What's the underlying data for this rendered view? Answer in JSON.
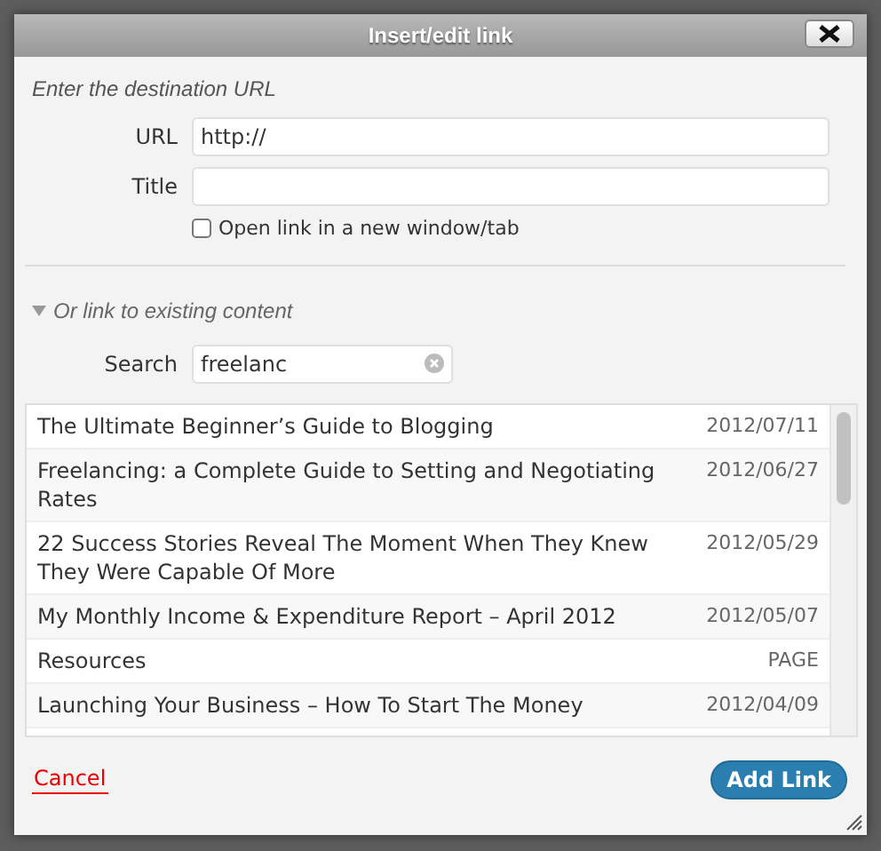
{
  "window": {
    "title": "Insert/edit link"
  },
  "url_section": {
    "heading": "Enter the destination URL",
    "fields": [
      {
        "label": "URL",
        "value": "http://"
      },
      {
        "label": "Title"
      }
    ],
    "new_window": {
      "label": "Open link in a new window/tab",
      "checked": false
    }
  },
  "existing": {
    "heading": "Or link to existing content",
    "expanded": true,
    "search": {
      "label": "Search",
      "value": "freelanc"
    },
    "results": [
      {
        "title": "The Ultimate Beginner’s Guide to Blogging",
        "info": "2012/07/11"
      },
      {
        "title": "Freelancing: a Complete Guide to Setting and Negotiating Rates",
        "info": "2012/06/27"
      },
      {
        "title": "22 Success Stories Reveal The Moment When They Knew They Were Capable Of More",
        "info": "2012/05/29"
      },
      {
        "title": "My Monthly Income & Expenditure Report – April 2012",
        "info": "2012/05/07"
      },
      {
        "title": "Resources",
        "info": "PAGE"
      },
      {
        "title": "Launching Your Business – How To Start The Money",
        "info": "2012/04/09"
      }
    ]
  },
  "footer": {
    "cancel": "Cancel",
    "submit": "Add Link"
  }
}
